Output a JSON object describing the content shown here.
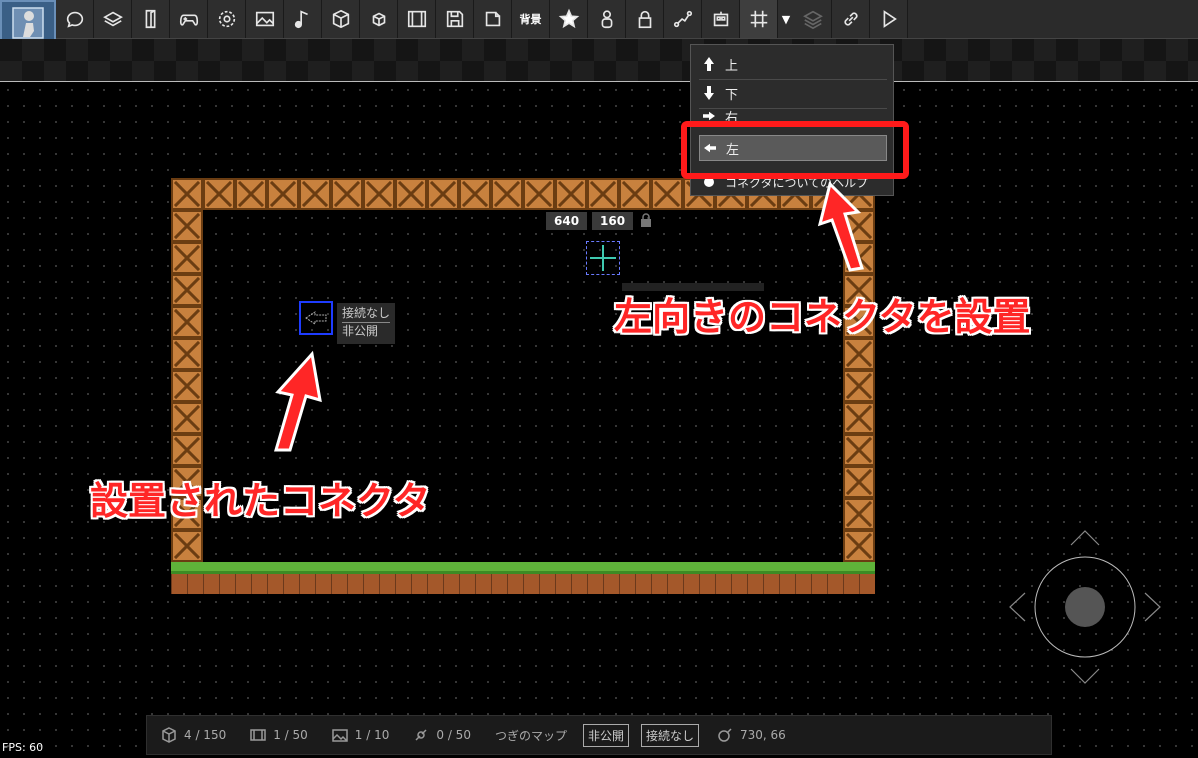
{
  "toolbar": {
    "background_label": "背景",
    "buttons": [
      "chat-icon",
      "layers-icon",
      "door-icon",
      "gamepad-icon",
      "gear-icon",
      "image-icon",
      "music-icon",
      "cube-icon",
      "small-cube-icon",
      "film-icon",
      "save-icon",
      "export-icon",
      "background-button",
      "star-icon",
      "person-icon",
      "lock-icon",
      "route-icon",
      "robot-icon",
      "grid-icon",
      "caret-down-icon",
      "stack-icon",
      "link-icon",
      "play-icon"
    ]
  },
  "canvas": {
    "coord_x": "640",
    "coord_y": "160"
  },
  "connector_tag": {
    "line1": "接続なし",
    "line2": "非公開"
  },
  "menu": {
    "items": [
      {
        "label": "上",
        "icon": "arrow-up-icon"
      },
      {
        "label": "下",
        "icon": "arrow-down-icon"
      },
      {
        "label": "右",
        "icon": "arrow-right-icon"
      },
      {
        "label": "左",
        "icon": "arrow-left-icon",
        "selected": true
      },
      {
        "label": "コネクタについてのヘルプ",
        "icon": "help-icon"
      }
    ]
  },
  "annotations": {
    "top_right": "左向きのコネクタを設置",
    "bottom_left": "設置されたコネクタ",
    "color": "#ff2626"
  },
  "status": {
    "blocks": "4 / 150",
    "frames": "1 / 50",
    "images": "1 / 10",
    "connections": "0 / 50",
    "next_map": "つぎのマップ",
    "visibility": "非公開",
    "connection": "接続なし",
    "cursor_pos": "730, 66"
  },
  "fps": "FPS: 60"
}
